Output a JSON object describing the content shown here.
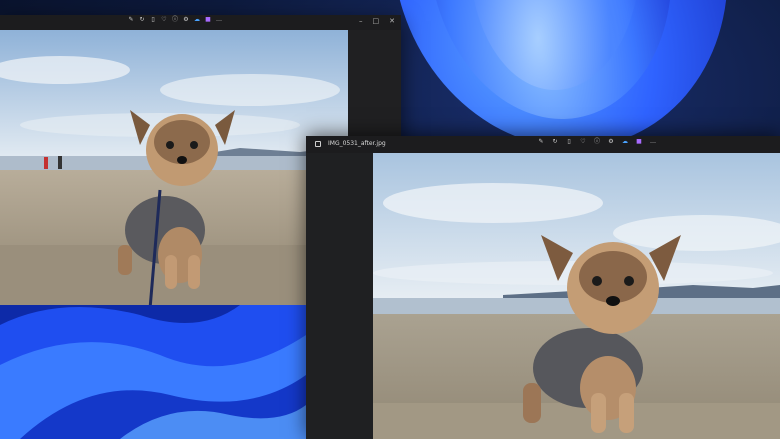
{
  "window_front": {
    "filename": "IMG_0531_after.jpg",
    "toolbar_icons": [
      "edit-icon",
      "rotate-icon",
      "delete-icon",
      "favorite-icon",
      "info-icon",
      "settings-icon",
      "onedrive-icon",
      "clipchamp-icon",
      "more-icon"
    ],
    "controls": [
      "minimize-icon",
      "maximize-icon",
      "close-icon"
    ]
  },
  "window_back": {
    "toolbar_icons": [
      "edit-icon",
      "rotate-icon",
      "delete-icon",
      "favorite-icon",
      "info-icon",
      "settings-icon",
      "onedrive-icon",
      "clipchamp-icon",
      "more-icon"
    ],
    "controls": [
      "minimize-icon",
      "maximize-icon",
      "close-icon"
    ]
  },
  "colors": {
    "wallpaper_blue": "#2f63ff",
    "titlebar": "#1c1c1e",
    "window_bg": "#202022",
    "sky": "#b8cde0",
    "sand": "#a59b89"
  }
}
